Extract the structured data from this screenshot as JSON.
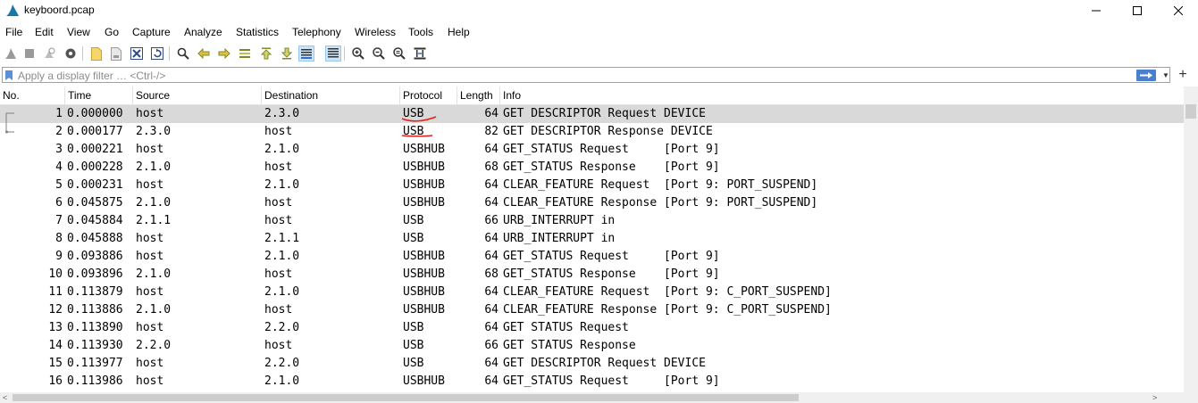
{
  "window": {
    "title": "keyboord.pcap",
    "accent": "#0078d7"
  },
  "menu": [
    "File",
    "Edit",
    "View",
    "Go",
    "Capture",
    "Analyze",
    "Statistics",
    "Telephony",
    "Wireless",
    "Tools",
    "Help"
  ],
  "toolbar": {
    "icons": [
      "start-capture",
      "stop-capture",
      "restart-capture",
      "capture-options",
      "open-file",
      "save-file",
      "close-file",
      "reload-file",
      "find-packet",
      "go-back",
      "go-forward",
      "go-to-packet",
      "go-first",
      "go-last",
      "autoscroll",
      "colorize",
      "zoom-in",
      "zoom-out",
      "normal-size",
      "resize-columns"
    ]
  },
  "filter": {
    "placeholder": "Apply a display filter … <Ctrl-/>",
    "value": ""
  },
  "columns": [
    "No.",
    "Time",
    "Source",
    "Destination",
    "Protocol",
    "Length",
    "Info"
  ],
  "packets": [
    {
      "no": "1",
      "time": "0.000000",
      "src": "host",
      "dst": "2.3.0",
      "proto": "USB",
      "len": "64",
      "info": "GET DESCRIPTOR Request DEVICE"
    },
    {
      "no": "2",
      "time": "0.000177",
      "src": "2.3.0",
      "dst": "host",
      "proto": "USB",
      "len": "82",
      "info": "GET DESCRIPTOR Response DEVICE"
    },
    {
      "no": "3",
      "time": "0.000221",
      "src": "host",
      "dst": "2.1.0",
      "proto": "USBHUB",
      "len": "64",
      "info": "GET_STATUS Request     [Port 9]"
    },
    {
      "no": "4",
      "time": "0.000228",
      "src": "2.1.0",
      "dst": "host",
      "proto": "USBHUB",
      "len": "68",
      "info": "GET_STATUS Response    [Port 9]"
    },
    {
      "no": "5",
      "time": "0.000231",
      "src": "host",
      "dst": "2.1.0",
      "proto": "USBHUB",
      "len": "64",
      "info": "CLEAR_FEATURE Request  [Port 9: PORT_SUSPEND]"
    },
    {
      "no": "6",
      "time": "0.045875",
      "src": "2.1.0",
      "dst": "host",
      "proto": "USBHUB",
      "len": "64",
      "info": "CLEAR_FEATURE Response [Port 9: PORT_SUSPEND]"
    },
    {
      "no": "7",
      "time": "0.045884",
      "src": "2.1.1",
      "dst": "host",
      "proto": "USB",
      "len": "66",
      "info": "URB_INTERRUPT in"
    },
    {
      "no": "8",
      "time": "0.045888",
      "src": "host",
      "dst": "2.1.1",
      "proto": "USB",
      "len": "64",
      "info": "URB_INTERRUPT in"
    },
    {
      "no": "9",
      "time": "0.093886",
      "src": "host",
      "dst": "2.1.0",
      "proto": "USBHUB",
      "len": "64",
      "info": "GET_STATUS Request     [Port 9]"
    },
    {
      "no": "10",
      "time": "0.093896",
      "src": "2.1.0",
      "dst": "host",
      "proto": "USBHUB",
      "len": "68",
      "info": "GET_STATUS Response    [Port 9]"
    },
    {
      "no": "11",
      "time": "0.113879",
      "src": "host",
      "dst": "2.1.0",
      "proto": "USBHUB",
      "len": "64",
      "info": "CLEAR_FEATURE Request  [Port 9: C_PORT_SUSPEND]"
    },
    {
      "no": "12",
      "time": "0.113886",
      "src": "2.1.0",
      "dst": "host",
      "proto": "USBHUB",
      "len": "64",
      "info": "CLEAR_FEATURE Response [Port 9: C_PORT_SUSPEND]"
    },
    {
      "no": "13",
      "time": "0.113890",
      "src": "host",
      "dst": "2.2.0",
      "proto": "USB",
      "len": "64",
      "info": "GET STATUS Request"
    },
    {
      "no": "14",
      "time": "0.113930",
      "src": "2.2.0",
      "dst": "host",
      "proto": "USB",
      "len": "66",
      "info": "GET STATUS Response"
    },
    {
      "no": "15",
      "time": "0.113977",
      "src": "host",
      "dst": "2.2.0",
      "proto": "USB",
      "len": "64",
      "info": "GET DESCRIPTOR Request DEVICE"
    },
    {
      "no": "16",
      "time": "0.113986",
      "src": "host",
      "dst": "2.1.0",
      "proto": "USBHUB",
      "len": "64",
      "info": "GET_STATUS Request     [Port 9]"
    }
  ]
}
